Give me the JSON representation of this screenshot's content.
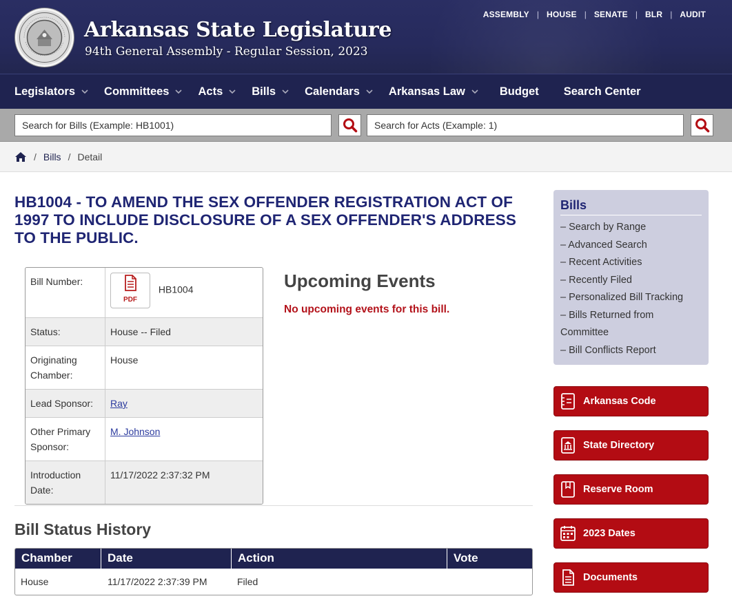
{
  "header": {
    "title": "Arkansas State Legislature",
    "subtitle": "94th General Assembly - Regular Session, 2023",
    "top_links": [
      "ASSEMBLY",
      "HOUSE",
      "SENATE",
      "BLR",
      "AUDIT"
    ]
  },
  "nav": {
    "items": [
      {
        "label": "Legislators",
        "dropdown": true
      },
      {
        "label": "Committees",
        "dropdown": true
      },
      {
        "label": "Acts",
        "dropdown": true
      },
      {
        "label": "Bills",
        "dropdown": true
      },
      {
        "label": "Calendars",
        "dropdown": true
      },
      {
        "label": "Arkansas Law",
        "dropdown": true
      },
      {
        "label": "Budget",
        "dropdown": false
      },
      {
        "label": "Search Center",
        "dropdown": false
      }
    ]
  },
  "search": {
    "bills_placeholder": "Search for Bills (Example: HB1001)",
    "acts_placeholder": "Search for Acts (Example: 1)"
  },
  "breadcrumb": {
    "items": [
      "Bills",
      "Detail"
    ]
  },
  "bill": {
    "title": "HB1004 - TO AMEND THE SEX OFFENDER REGISTRATION ACT OF 1997 TO INCLUDE DISCLOSURE OF A SEX OFFENDER'S ADDRESS TO THE PUBLIC.",
    "pdf_label": "PDF",
    "rows": [
      {
        "label": "Bill Number:",
        "value": "HB1004"
      },
      {
        "label": "Status:",
        "value": "House -- Filed"
      },
      {
        "label": "Originating Chamber:",
        "value": "House"
      },
      {
        "label": "Lead Sponsor:",
        "value": "Ray"
      },
      {
        "label": "Other Primary Sponsor:",
        "value": "M. Johnson"
      },
      {
        "label": "Introduction Date:",
        "value": "11/17/2022 2:37:32 PM"
      }
    ]
  },
  "upcoming": {
    "title": "Upcoming Events",
    "message": "No upcoming events for this bill."
  },
  "history": {
    "title": "Bill Status History",
    "columns": [
      "Chamber",
      "Date",
      "Action",
      "Vote"
    ],
    "rows": [
      {
        "chamber": "House",
        "date": "11/17/2022 2:37:39 PM",
        "action": "Filed",
        "vote": ""
      }
    ]
  },
  "sidebar": {
    "bills_title": "Bills",
    "bills_links": [
      "– Search by Range",
      "– Advanced Search",
      "– Recent Activities",
      "– Recently Filed",
      "– Personalized Bill Tracking",
      "– Bills Returned from Committee",
      "– Bill Conflicts Report"
    ],
    "buttons": [
      {
        "label": "Arkansas Code",
        "icon": "code-book-icon"
      },
      {
        "label": "State Directory",
        "icon": "directory-building-icon"
      },
      {
        "label": "Reserve Room",
        "icon": "bookmark-icon"
      },
      {
        "label": "2023 Dates",
        "icon": "calendar-icon"
      },
      {
        "label": "Documents",
        "icon": "documents-icon"
      }
    ]
  },
  "colors": {
    "navy": "#1f2350",
    "title_blue": "#1f2573",
    "red": "#b30c13",
    "sidebar_bg": "#cdcedf"
  }
}
